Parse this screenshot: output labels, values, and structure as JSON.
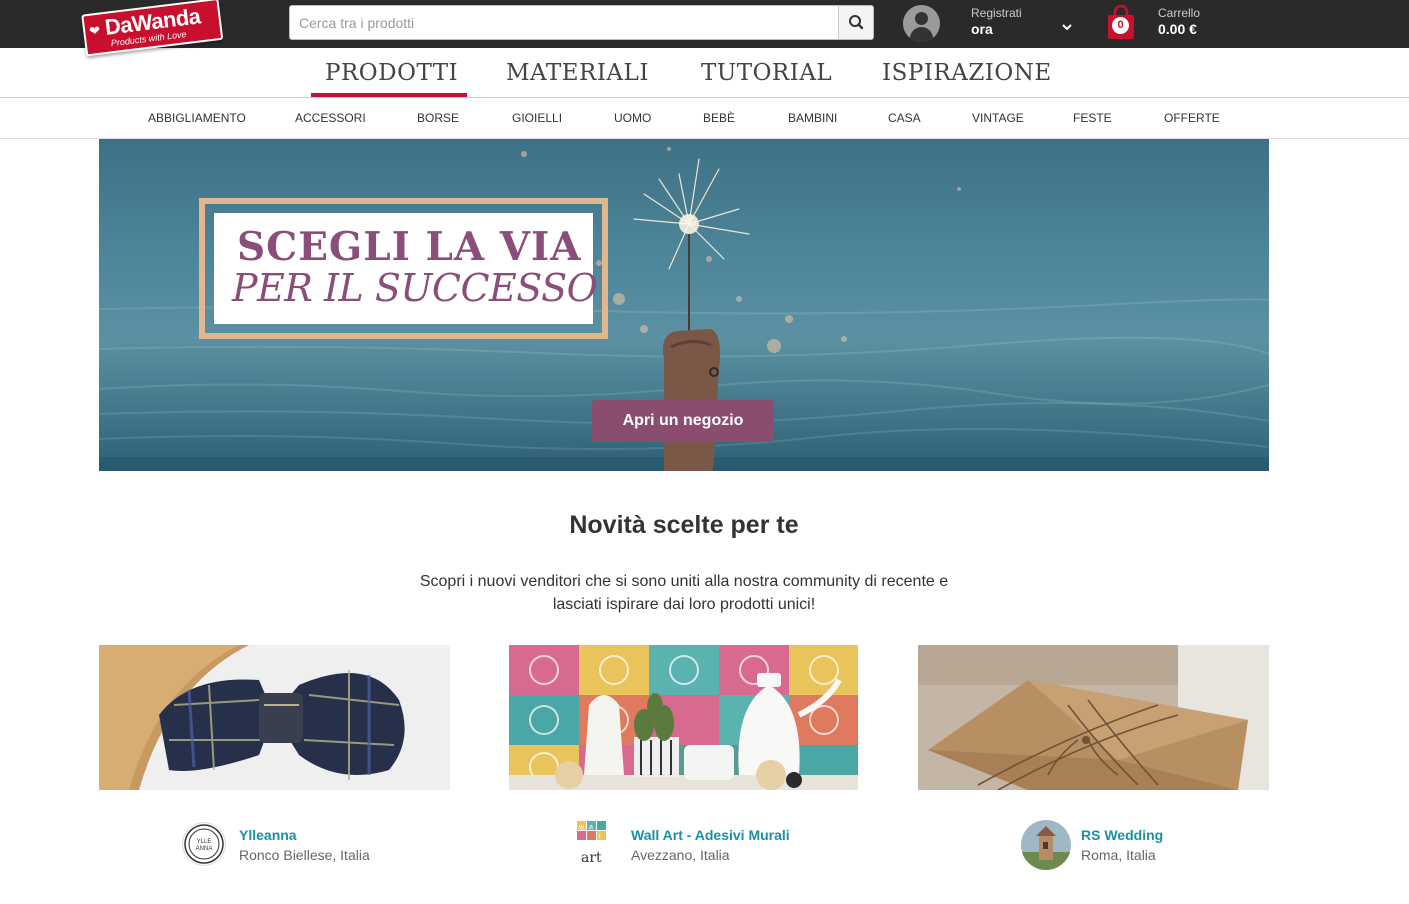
{
  "brand": {
    "name": "DaWanda",
    "tagline": "Products with Love",
    "color": "#c8102e"
  },
  "search": {
    "placeholder": "Cerca tra i prodotti",
    "icon": "search-icon"
  },
  "account": {
    "line1": "Registrati",
    "line2": "ora"
  },
  "cart": {
    "count": "0",
    "label": "Carrello",
    "total": "0.00 €"
  },
  "main_nav": {
    "tabs": [
      "PRODOTTI",
      "MATERIALI",
      "TUTORIAL",
      "ISPIRAZIONE"
    ],
    "active": "PRODOTTI"
  },
  "sub_nav": {
    "items": [
      "ABBIGLIAMENTO",
      "ACCESSORI",
      "BORSE",
      "GIOIELLI",
      "UOMO",
      "BEBÈ",
      "BAMBINI",
      "CASA",
      "VINTAGE",
      "FESTE",
      "OFFERTE"
    ]
  },
  "hero": {
    "line1": "SCEGLI LA VIA",
    "line2": "PER IL SUCCESSO",
    "cta": "Apri un negozio"
  },
  "section": {
    "title": "Novità scelte per te",
    "description_line1": "Scopri i nuovi venditori che si sono uniti alla nostra community di recente e",
    "description_line2": "lasciati ispirare dai loro prodotti unici!"
  },
  "shops": [
    {
      "name": "Ylleanna",
      "location": "Ronco Biellese, Italia",
      "avatar_text": "YLLE ANNA"
    },
    {
      "name": "Wall Art - Adesivi Murali",
      "location": "Avezzano, Italia",
      "avatar_text": "wall art"
    },
    {
      "name": "RS Wedding",
      "location": "Roma, Italia",
      "avatar_text": ""
    }
  ]
}
